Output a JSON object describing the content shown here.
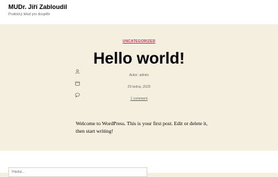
{
  "header": {
    "site_title": "MUDr. Jiří Zabloudil",
    "site_description": "Praktický lékař pro dospělé"
  },
  "post": {
    "category": "UNCATEGORIZED",
    "title": "Hello world!",
    "meta": {
      "author": "Autor: admin",
      "date": "29 ledna, 2020",
      "comments": "1 comment"
    },
    "content": "Welcome to WordPress. This is your first post. Edit or delete it, then start writing!"
  },
  "search": {
    "placeholder": "Hledat..."
  },
  "icons": [
    "user-icon",
    "calendar-icon",
    "comment-icon"
  ],
  "colors": {
    "background": "#f5efe0",
    "accent": "#cd2653"
  }
}
